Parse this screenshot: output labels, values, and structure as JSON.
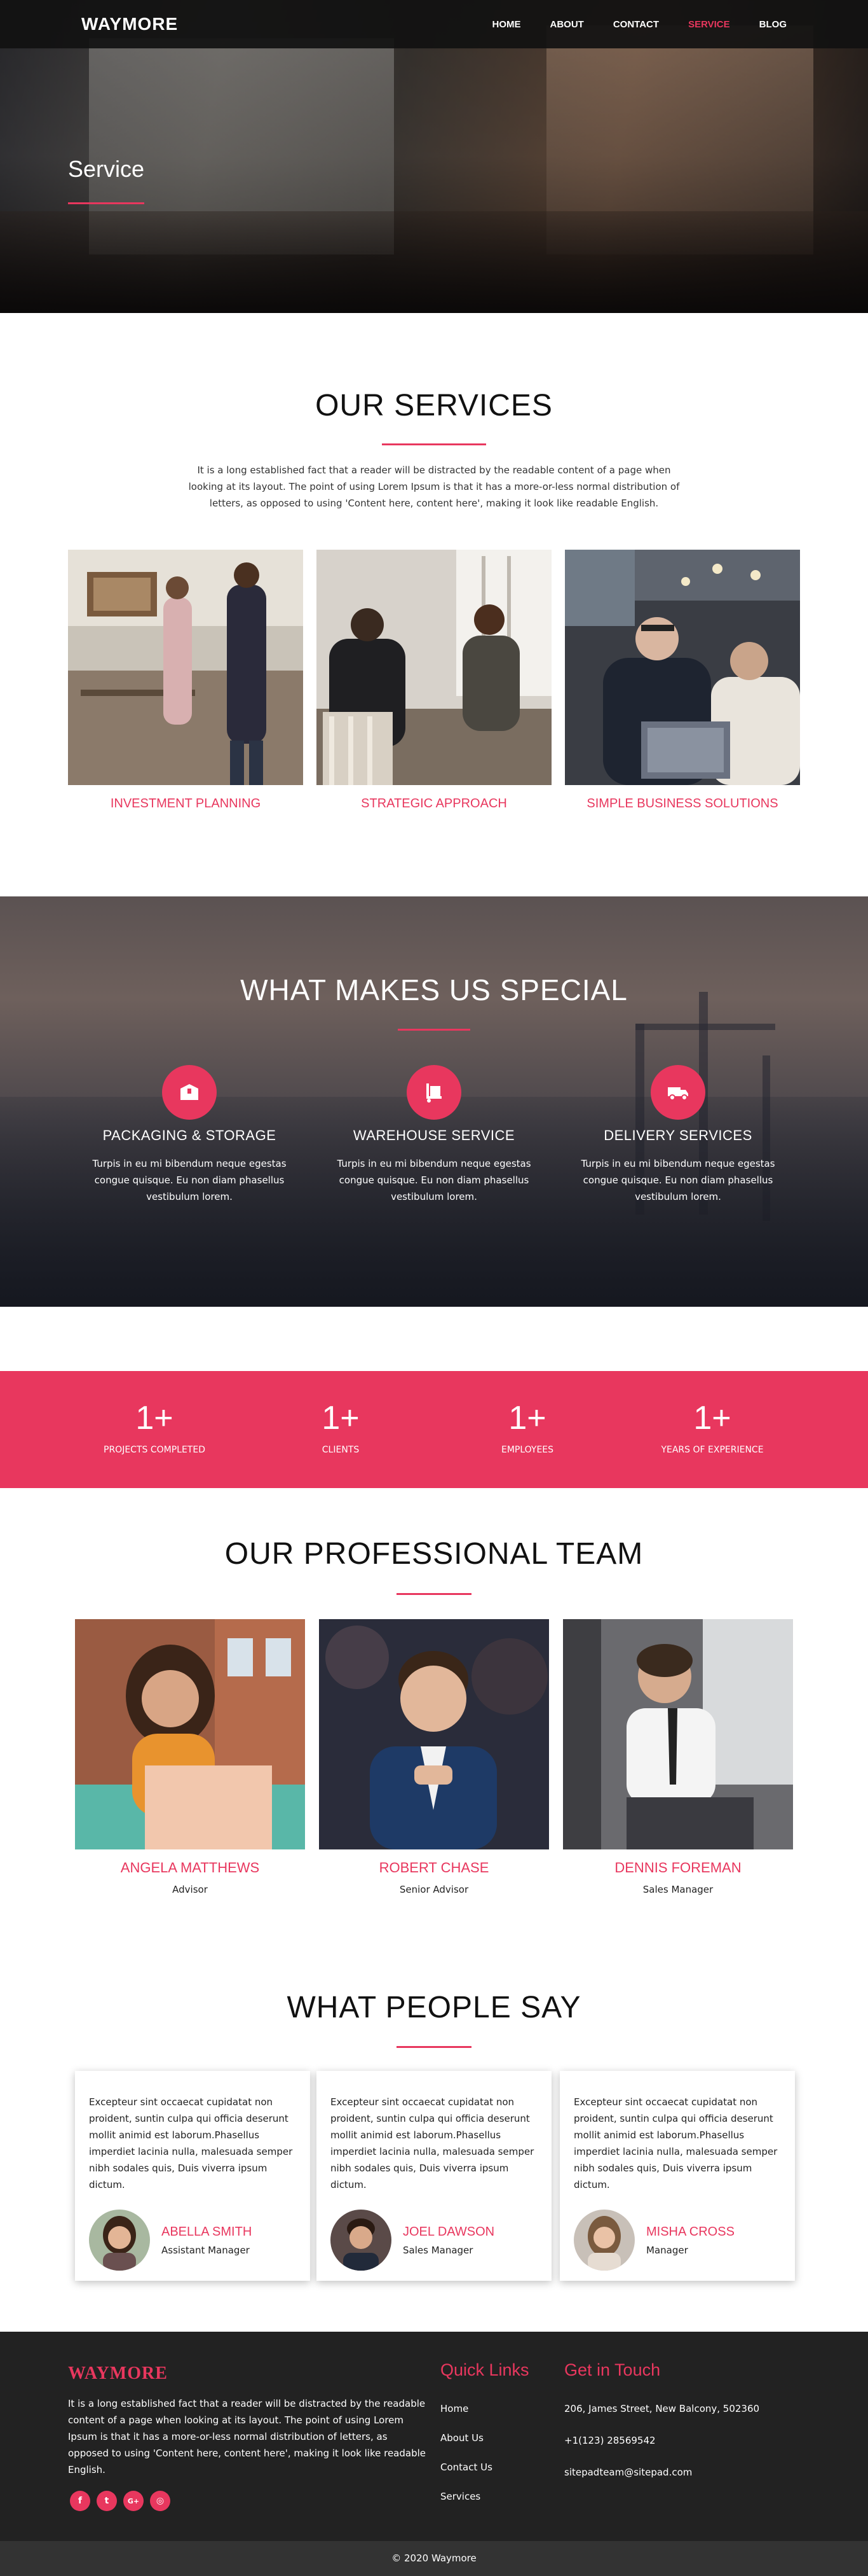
{
  "nav": {
    "brand": "WAYMORE",
    "items": [
      {
        "label": "HOME"
      },
      {
        "label": "ABOUT"
      },
      {
        "label": "CONTACT"
      },
      {
        "label": "SERVICE",
        "active": true
      },
      {
        "label": "BLOG"
      }
    ]
  },
  "hero": {
    "title": "Service"
  },
  "services": {
    "title": "OUR SERVICES",
    "intro": "It is a long established fact that a reader will be distracted by the readable content of a page when looking at its layout. The point of using Lorem Ipsum is that it has a more-or-less normal distribution of letters, as opposed to using 'Content here, content here', making it look like readable English.",
    "cards": [
      {
        "label": "INVESTMENT PLANNING"
      },
      {
        "label": "STRATEGIC APPROACH"
      },
      {
        "label": "SIMPLE BUSINESS SOLUTIONS"
      }
    ]
  },
  "special": {
    "title": "WHAT MAKES US SPECIAL",
    "features": [
      {
        "title": "PACKAGING & STORAGE",
        "text": "Turpis in eu mi bibendum neque egestas congue quisque. Eu non diam phasellus vestibulum lorem.",
        "icon": "box-icon"
      },
      {
        "title": "WAREHOUSE SERVICE",
        "text": "Turpis in eu mi bibendum neque egestas congue quisque. Eu non diam phasellus vestibulum lorem.",
        "icon": "hand-truck-icon"
      },
      {
        "title": "DELIVERY SERVICES",
        "text": "Turpis in eu mi bibendum neque egestas congue quisque. Eu non diam phasellus vestibulum lorem.",
        "icon": "truck-icon"
      }
    ]
  },
  "stats": [
    {
      "num": "1+",
      "label": "PROJECTS COMPLETED"
    },
    {
      "num": "1+",
      "label": "CLIENTS"
    },
    {
      "num": "1+",
      "label": "EMPLOYEES"
    },
    {
      "num": "1+",
      "label": "YEARS OF EXPERIENCE"
    }
  ],
  "team": {
    "title": "OUR PROFESSIONAL TEAM",
    "members": [
      {
        "name": "ANGELA MATTHEWS",
        "role": "Advisor"
      },
      {
        "name": "ROBERT CHASE",
        "role": "Senior Advisor"
      },
      {
        "name": "DENNIS FOREMAN",
        "role": "Sales Manager"
      }
    ]
  },
  "testimonials": {
    "title": "WHAT PEOPLE SAY",
    "items": [
      {
        "text": "Excepteur sint occaecat cupidatat non proident, suntin culpa qui officia deserunt mollit animid est laborum.Phasellus imperdiet lacinia nulla, malesuada semper nibh sodales quis, Duis viverra ipsum dictum.",
        "name": "ABELLA SMITH",
        "role": "Assistant Manager"
      },
      {
        "text": "Excepteur sint occaecat cupidatat non proident, suntin culpa qui officia deserunt mollit animid est laborum.Phasellus imperdiet lacinia nulla, malesuada semper nibh sodales quis, Duis viverra ipsum dictum.",
        "name": "JOEL DAWSON",
        "role": "Sales Manager"
      },
      {
        "text": "Excepteur sint occaecat cupidatat non proident, suntin culpa qui officia deserunt mollit animid est laborum.Phasellus imperdiet lacinia nulla, malesuada semper nibh sodales quis, Duis viverra ipsum dictum.",
        "name": "MISHA CROSS",
        "role": "Manager"
      }
    ]
  },
  "footer": {
    "brand": "WAYMORE",
    "description": "It is a long established fact that a reader will be distracted by the readable content of a page when looking at its layout. The point of using Lorem Ipsum is that it has a more-or-less normal distribution of letters, as opposed to using 'Content here, content here', making it look like readable English.",
    "socials": [
      {
        "glyph": "f",
        "icon": "facebook-icon"
      },
      {
        "glyph": "t",
        "icon": "twitter-icon"
      },
      {
        "glyph": "G+",
        "icon": "google-plus-icon"
      },
      {
        "glyph": "◎",
        "icon": "instagram-icon"
      }
    ],
    "quick_links_title": "Quick Links",
    "links": [
      {
        "label": "Home"
      },
      {
        "label": "About Us"
      },
      {
        "label": "Contact Us"
      },
      {
        "label": "Services"
      }
    ],
    "touch_title": "Get in Touch",
    "address": "206, James Street, New Balcony, 502360",
    "phone": "+1(123) 28569542",
    "email": "sitepadteam@sitepad.com",
    "copyright": "© 2020 Waymore"
  },
  "colors": {
    "accent": "#e8375e",
    "dark": "#222222",
    "nav": "#111111"
  }
}
